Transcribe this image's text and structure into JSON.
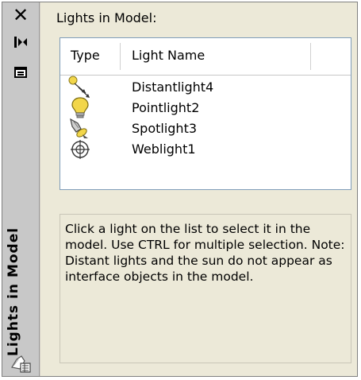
{
  "palette": {
    "title": "Lights in Model",
    "buttons": {
      "close_glyph": "✕",
      "autohide_icon": "autohide-icon",
      "properties_icon": "properties-icon"
    }
  },
  "lights": {
    "section_label": "Lights in Model:",
    "columns": [
      "Type",
      "Light Name"
    ],
    "rows": [
      {
        "name": "Distantlight4",
        "icon": "distant-light-icon"
      },
      {
        "name": "Pointlight2",
        "icon": "point-light-icon"
      },
      {
        "name": "Spotlight3",
        "icon": "spot-light-icon"
      },
      {
        "name": "Weblight1",
        "icon": "web-light-icon"
      }
    ]
  },
  "note": {
    "text": "Click a light on the list to select it in the model. Use CTRL for multiple selection. Note: Distant lights and the sun do not appear as interface objects in the model."
  },
  "colors": {
    "panel_bg": "#ece9d8",
    "titlebar_bg": "#c8c8c8",
    "list_border": "#7f9db9",
    "bulb_yellow": "#f2d64a"
  }
}
